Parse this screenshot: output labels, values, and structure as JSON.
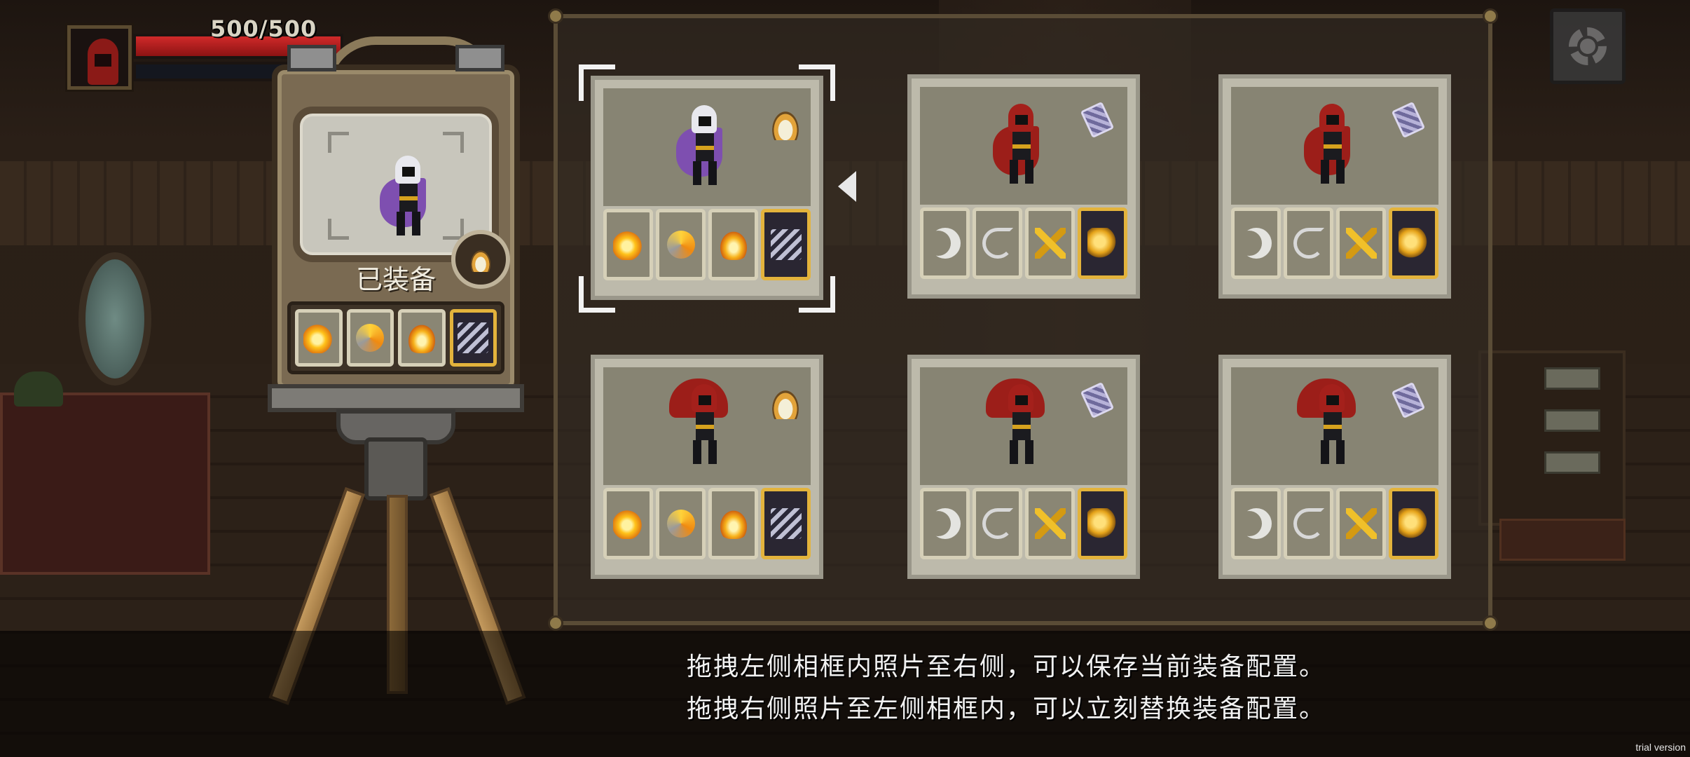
{
  "hud": {
    "hp_text": "500/500",
    "hp_fraction": 1.0,
    "portrait_icon": "red-hooded-hero-portrait",
    "settings_icon": "gear-icon"
  },
  "camera": {
    "equipped_label": "已装备",
    "relic_icon": "bowl-relic-icon",
    "character": "white-hooded-mage",
    "skills": [
      "fire-burst",
      "fire-swirl",
      "flame-drop",
      "dark-arcana"
    ]
  },
  "presets": [
    {
      "id": 1,
      "selected": true,
      "character": "white-hooded-mage",
      "relic": "bowl-relic-icon",
      "skills": [
        "fire-burst",
        "fire-swirl",
        "flame-drop",
        "dark-arcana"
      ]
    },
    {
      "id": 2,
      "selected": false,
      "character": "red-hooded-hero",
      "relic": "card-relic-icon",
      "skills": [
        "crescent-slash",
        "hook-dash",
        "gold-cross",
        "gold-orb"
      ]
    },
    {
      "id": 3,
      "selected": false,
      "character": "red-hooded-hero",
      "relic": "card-relic-icon",
      "skills": [
        "crescent-slash",
        "hook-dash",
        "gold-cross",
        "gold-orb"
      ]
    },
    {
      "id": 4,
      "selected": false,
      "character": "red-hooded-hero",
      "relic": "bowl-relic-icon",
      "skills": [
        "fire-burst",
        "fire-swirl",
        "flame-drop",
        "dark-arcana"
      ]
    },
    {
      "id": 5,
      "selected": false,
      "character": "red-hooded-hero",
      "relic": "card-relic-icon",
      "skills": [
        "crescent-slash",
        "hook-dash",
        "gold-cross",
        "gold-orb"
      ]
    },
    {
      "id": 6,
      "selected": false,
      "character": "red-hooded-hero",
      "relic": "card-relic-icon",
      "skills": [
        "crescent-slash",
        "hook-dash",
        "gold-cross",
        "gold-orb"
      ]
    }
  ],
  "hints": {
    "line1": "拖拽左侧相框内照片至右侧，可以保存当前装备配置。",
    "line2": "拖拽右侧照片至左侧相框内，可以立刻替换装备配置。"
  },
  "watermark": "trial version",
  "colors": {
    "hp": "#d02a2a",
    "slot_gold_border": "#e3b33c",
    "selector": "#f2f2f2"
  }
}
